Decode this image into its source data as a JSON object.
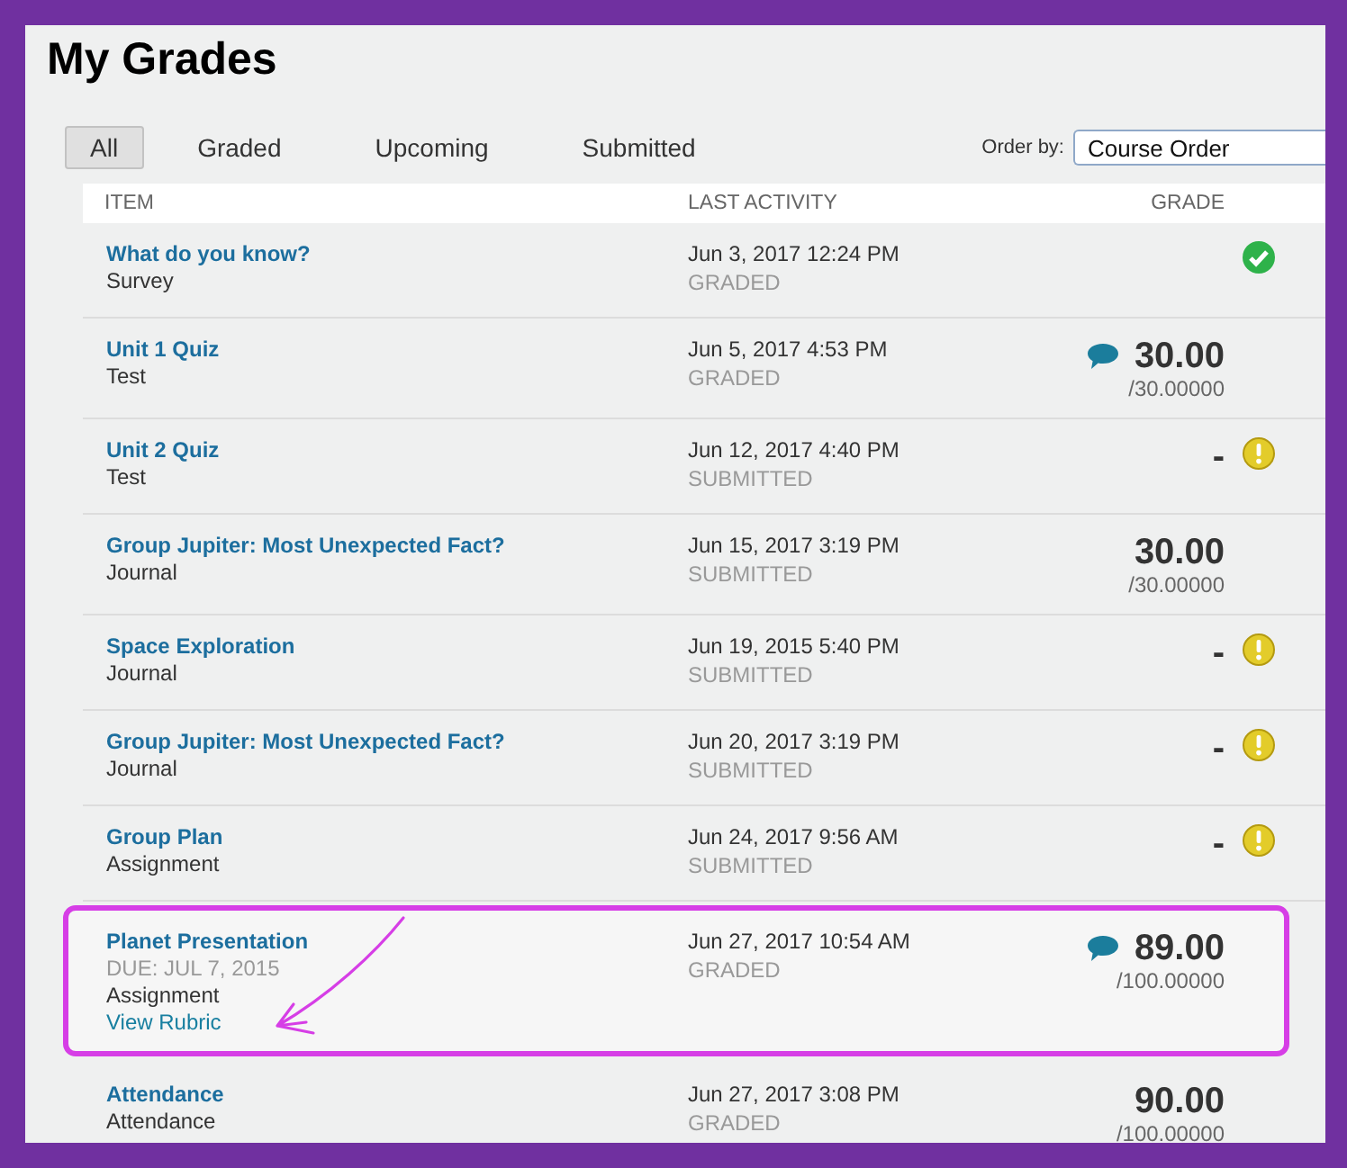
{
  "title": "My Grades",
  "filters": [
    {
      "label": "All",
      "selected": true
    },
    {
      "label": "Graded",
      "selected": false
    },
    {
      "label": "Upcoming",
      "selected": false
    },
    {
      "label": "Submitted",
      "selected": false
    }
  ],
  "order_by": {
    "label": "Order by:",
    "value": "Course Order"
  },
  "columns": [
    "ITEM",
    "LAST ACTIVITY",
    "GRADE"
  ],
  "rows": [
    {
      "title": "What do you know?",
      "type": "Survey",
      "date": "Jun 3, 2017 12:24 PM",
      "status": "GRADED",
      "comment": false,
      "status_icon": {
        "kind": "check"
      },
      "highlighted": false
    },
    {
      "title": "Unit 1 Quiz",
      "type": "Test",
      "date": "Jun 5, 2017 4:53 PM",
      "status": "GRADED",
      "grade": "30.00",
      "out_of": "/30.00000",
      "comment": true,
      "highlighted": false
    },
    {
      "title": "Unit 2 Quiz",
      "type": "Test",
      "date": "Jun 12, 2017 4:40 PM",
      "status": "SUBMITTED",
      "grade": "-",
      "comment": false,
      "status_icon": {
        "kind": "alert"
      },
      "highlighted": false
    },
    {
      "title": "Group Jupiter: Most Unexpected Fact?",
      "type": "Journal",
      "date": "Jun 15, 2017 3:19 PM",
      "status": "SUBMITTED",
      "grade": "30.00",
      "out_of": "/30.00000",
      "comment": false,
      "highlighted": false
    },
    {
      "title": "Space Exploration",
      "type": "Journal",
      "date": "Jun 19, 2015 5:40 PM",
      "status": "SUBMITTED",
      "grade": "-",
      "comment": false,
      "status_icon": {
        "kind": "alert"
      },
      "highlighted": false
    },
    {
      "title": "Group Jupiter: Most Unexpected Fact?",
      "type": "Journal",
      "date": "Jun 20, 2017 3:19 PM",
      "status": "SUBMITTED",
      "grade": "-",
      "comment": false,
      "status_icon": {
        "kind": "alert"
      },
      "highlighted": false
    },
    {
      "title": "Group Plan",
      "type": "Assignment",
      "date": "Jun 24, 2017 9:56 AM",
      "status": "SUBMITTED",
      "grade": "-",
      "comment": false,
      "status_icon": {
        "kind": "alert"
      },
      "highlighted": false
    },
    {
      "title": "Planet Presentation",
      "due": "DUE: JUL 7, 2015",
      "type": "Assignment",
      "link": "View Rubric",
      "date": "Jun 27, 2017 10:54 AM",
      "status": "GRADED",
      "grade": "89.00",
      "out_of": "/100.00000",
      "comment": true,
      "highlighted": true
    },
    {
      "title": "Attendance",
      "type": "Attendance",
      "date": "Jun 27, 2017 3:08 PM",
      "status": "GRADED",
      "grade": "90.00",
      "out_of": "/100.00000",
      "comment": false,
      "highlighted": false
    }
  ]
}
